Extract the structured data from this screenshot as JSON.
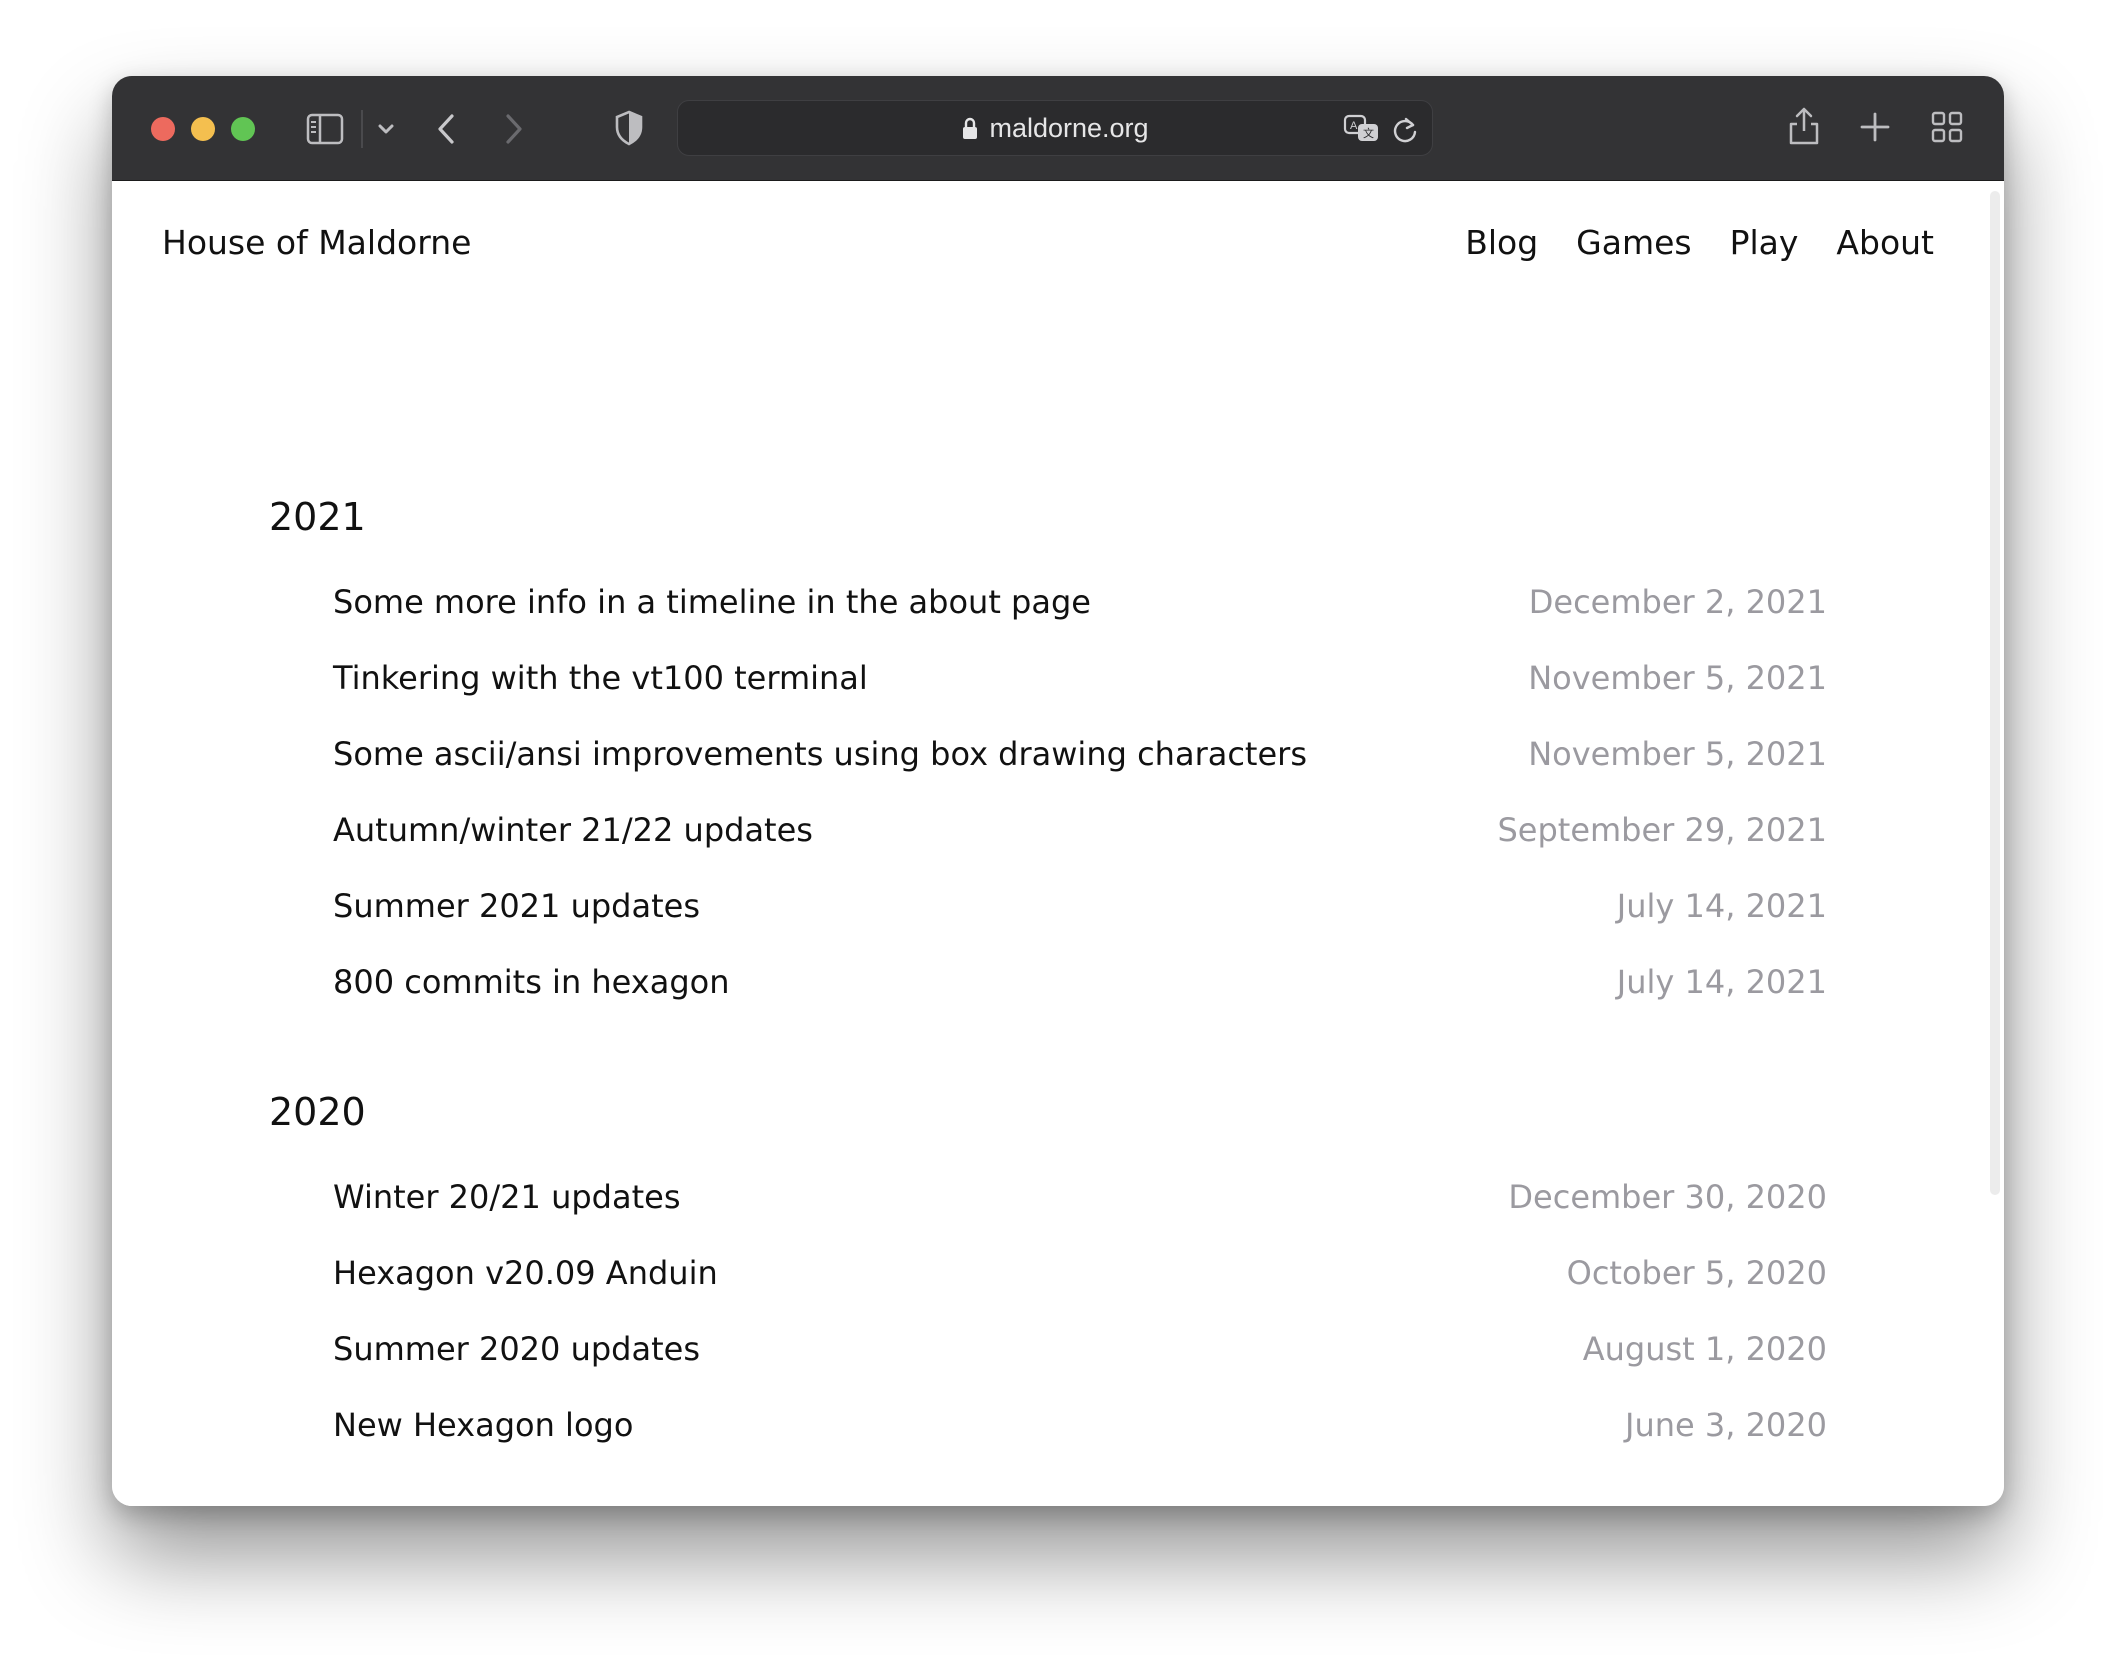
{
  "browser": {
    "url": "maldorne.org",
    "icons": {
      "traffic_lights": [
        "close",
        "minimize",
        "zoom"
      ],
      "left": [
        "sidebar-icon",
        "chevron-down-icon",
        "back-icon",
        "forward-icon",
        "privacy-shield-icon"
      ],
      "address": [
        "lock-icon",
        "translate-icon",
        "reload-icon"
      ],
      "right": [
        "share-icon",
        "new-tab-icon",
        "tab-overview-icon"
      ]
    }
  },
  "site": {
    "title": "House of Maldorne",
    "nav": [
      "Blog",
      "Games",
      "Play",
      "About"
    ]
  },
  "archive": [
    {
      "year": "2021",
      "posts": [
        {
          "title": "Some more info in a timeline in the about page",
          "date": "December 2, 2021"
        },
        {
          "title": "Tinkering with the vt100 terminal",
          "date": "November 5, 2021"
        },
        {
          "title": "Some ascii/ansi improvements using box drawing characters",
          "date": "November 5, 2021"
        },
        {
          "title": "Autumn/winter 21/22 updates",
          "date": "September 29, 2021"
        },
        {
          "title": "Summer 2021 updates",
          "date": "July 14, 2021"
        },
        {
          "title": "800 commits in hexagon",
          "date": "July 14, 2021"
        }
      ]
    },
    {
      "year": "2020",
      "posts": [
        {
          "title": "Winter 20/21 updates",
          "date": "December 30, 2020"
        },
        {
          "title": "Hexagon v20.09 Anduin",
          "date": "October 5, 2020"
        },
        {
          "title": "Summer 2020 updates",
          "date": "August 1, 2020"
        },
        {
          "title": "New Hexagon logo",
          "date": "June 3, 2020"
        }
      ]
    }
  ],
  "colors": {
    "toolbar": "#333335",
    "date_text": "#9b9aa0",
    "body_text": "#111111"
  }
}
